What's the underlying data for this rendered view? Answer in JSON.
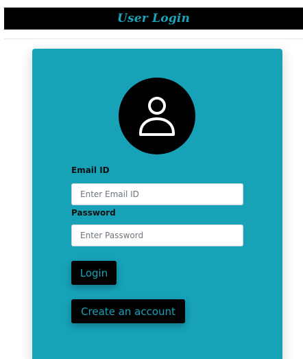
{
  "header": {
    "title": "User Login"
  },
  "form": {
    "avatar_icon": "user-icon",
    "email_label": "Email ID",
    "email_placeholder": "Enter Email ID",
    "email_value": "",
    "password_label": "Password",
    "password_placeholder": "Enter Password",
    "password_value": "",
    "login_label": "Login",
    "create_account_label": "Create an account"
  },
  "colors": {
    "card_background": "#17a2b8",
    "header_background": "#000000",
    "title_text": "#1aa3b8",
    "button_background": "#000000",
    "button_text": "#17a2b8"
  }
}
